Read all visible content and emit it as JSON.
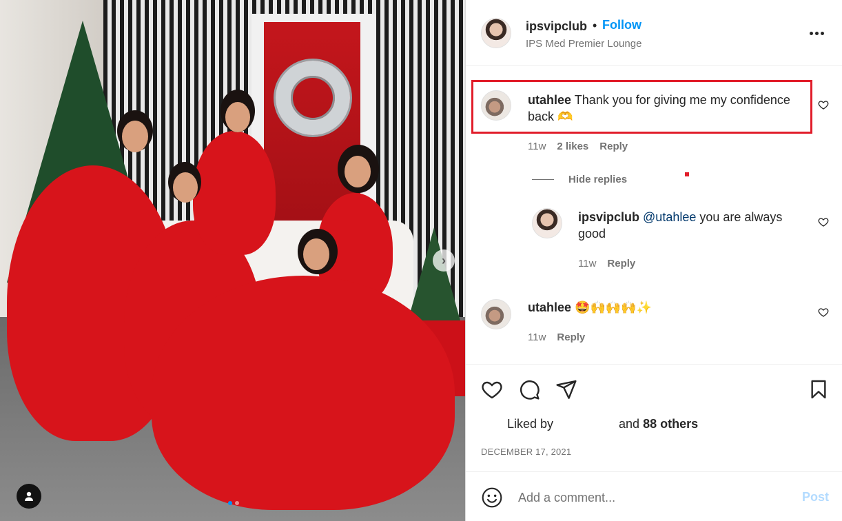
{
  "post": {
    "header": {
      "username": "ipsvipclub",
      "separator": "•",
      "follow_label": "Follow",
      "location": "IPS Med Premier Lounge"
    },
    "comments": [
      {
        "username": "utahlee",
        "text": "Thank you for giving me my confidence back 🫶",
        "time": "11w",
        "likes": "2 likes",
        "reply_label": "Reply"
      }
    ],
    "hide_replies_label": "Hide replies",
    "reply": {
      "username": "ipsvipclub",
      "mention": "@utahlee",
      "text": " you are always good",
      "time": "11w",
      "reply_label": "Reply"
    },
    "comment2": {
      "username": "utahlee",
      "text": "🤩🙌🙌🙌✨",
      "time": "11w",
      "reply_label": "Reply"
    },
    "likes": {
      "prefix": "Liked by",
      "and": "and",
      "count": "88 others"
    },
    "date": "DECEMBER 17, 2021",
    "add_comment": {
      "placeholder": "Add a comment...",
      "post_label": "Post"
    },
    "colors": {
      "accent": "#0095f6",
      "highlight": "#e11d2a",
      "post_disabled": "#b3dbff"
    }
  }
}
